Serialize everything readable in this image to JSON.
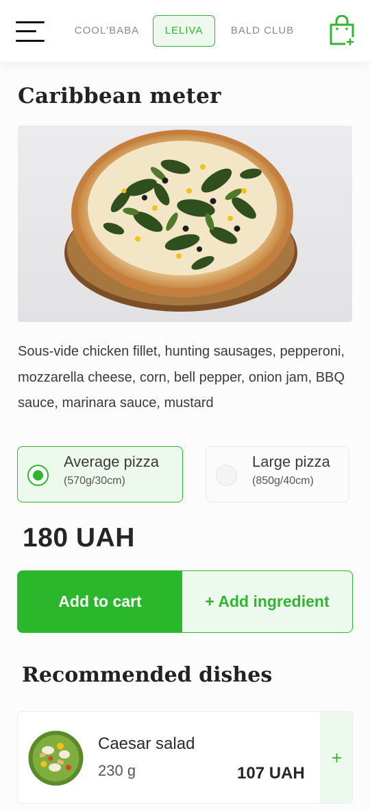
{
  "header": {
    "brands": [
      {
        "label": "COOL'BABA",
        "active": false
      },
      {
        "label": "LELIVA",
        "active": true
      },
      {
        "label": "BALD CLUB",
        "active": false
      }
    ],
    "menu_icon": "hamburger-menu-icon",
    "cart_icon": "shopping-bag-add-icon"
  },
  "product": {
    "title": "Caribbean meter",
    "description": "Sous-vide chicken fillet, hunting sausages, pepperoni, mozzarella cheese, corn, bell pepper, onion jam, BBQ sauce, marinara sauce, mustard",
    "sizes": [
      {
        "name": "Average pizza",
        "detail": "(570g/30cm)",
        "selected": true
      },
      {
        "name": "Large pizza",
        "detail": "(850g/40cm)",
        "selected": false
      }
    ],
    "price": "180 UAH",
    "add_to_cart_label": "Add to cart",
    "add_ingredient_label": "+ Add ingredient"
  },
  "recommended": {
    "title": "Recommended dishes",
    "items": [
      {
        "name": "Caesar salad",
        "weight": "230 g",
        "price": "107 UAH",
        "add_label": "+"
      }
    ]
  },
  "colors": {
    "accent": "#2fb52f",
    "accent_light": "#eef9ee"
  }
}
